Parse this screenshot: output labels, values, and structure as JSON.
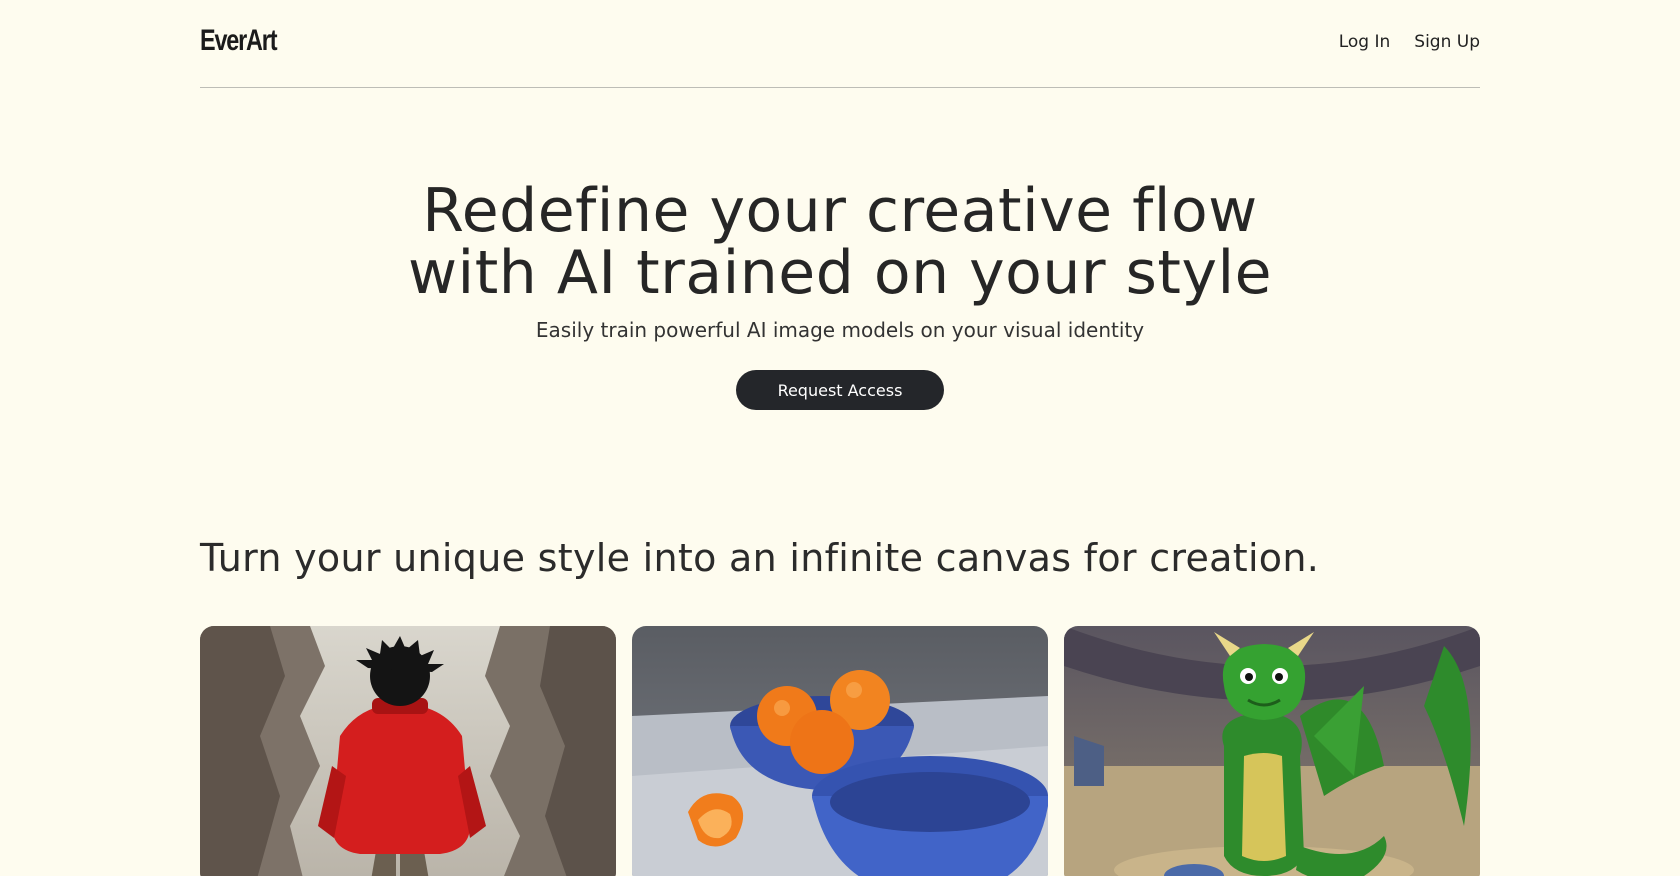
{
  "brand": {
    "name": "EverArt"
  },
  "nav": {
    "login": "Log In",
    "signup": "Sign Up"
  },
  "hero": {
    "title_line1": "Redefine your creative flow",
    "title_line2": "with AI trained on your style",
    "subtitle": "Easily train powerful AI image models on your visual identity",
    "cta_label": "Request Access"
  },
  "section": {
    "title": "Turn your unique style into an infinite canvas for creation."
  },
  "colors": {
    "background": "#fefcef",
    "cta_background": "#24262a",
    "divider": "#bdbdb6"
  }
}
